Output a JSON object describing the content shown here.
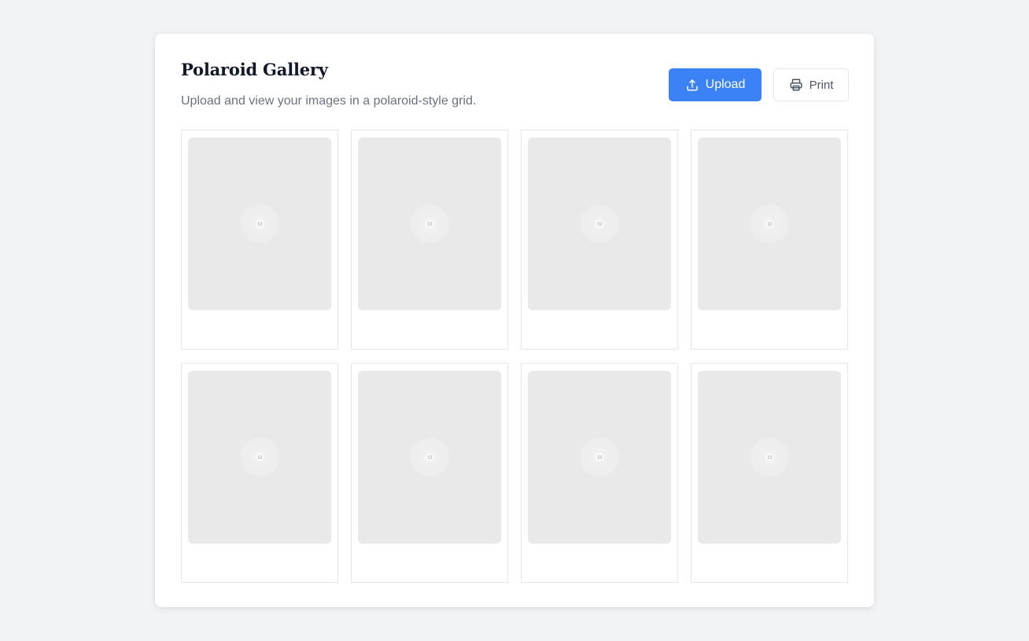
{
  "header": {
    "title": "Polaroid Gallery",
    "subtitle": "Upload and view your images in a polaroid-style grid."
  },
  "actions": {
    "upload_label": "Upload",
    "upload_icon": "upload-icon",
    "print_label": "Print",
    "print_icon": "printer-icon"
  },
  "colors": {
    "accent": "#3b82f6",
    "background": "#f2f3f5",
    "photo_placeholder": "#e9e9ea"
  },
  "gallery": {
    "items": [
      {
        "icon": "image-placeholder-icon"
      },
      {
        "icon": "image-placeholder-icon"
      },
      {
        "icon": "image-placeholder-icon"
      },
      {
        "icon": "image-placeholder-icon"
      },
      {
        "icon": "image-placeholder-icon"
      },
      {
        "icon": "image-placeholder-icon"
      },
      {
        "icon": "image-placeholder-icon"
      },
      {
        "icon": "image-placeholder-icon"
      }
    ]
  }
}
